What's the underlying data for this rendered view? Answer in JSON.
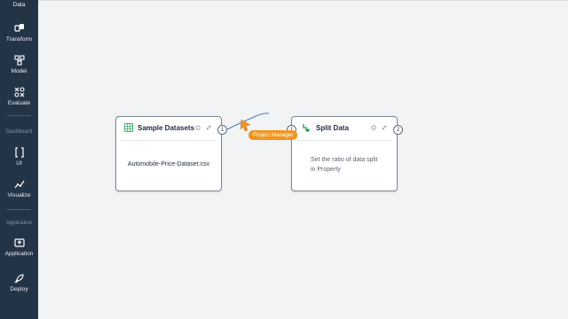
{
  "sidebar": {
    "items": [
      {
        "label": "Data",
        "icon": "data-icon"
      },
      {
        "label": "Transform",
        "icon": "transform-icon"
      },
      {
        "label": "Model",
        "icon": "model-icon"
      },
      {
        "label": "Evaluate",
        "icon": "evaluate-icon"
      },
      {
        "label": "UI",
        "icon": "brackets-icon"
      },
      {
        "label": "Visualize",
        "icon": "chart-line-icon"
      },
      {
        "label": "Application",
        "icon": "application-icon"
      },
      {
        "label": "Deploy",
        "icon": "rocket-icon"
      }
    ],
    "sections": {
      "dashboard": "Dashboard",
      "application": "Application"
    }
  },
  "nodes": {
    "sample": {
      "title": "Sample Datasets",
      "body": "Automobile-Price-Dataset.csv",
      "output_port": "1"
    },
    "split": {
      "title": "Split Data",
      "body": "Set the ratio of data split in Property",
      "input_port": "1",
      "output_port": "2"
    }
  },
  "tooltip": {
    "text": "Project Manager"
  },
  "colors": {
    "sidebar": "#243447",
    "canvas": "#f2f3f5",
    "tooltip": "#f0961e",
    "accent_green": "#3cb371"
  }
}
